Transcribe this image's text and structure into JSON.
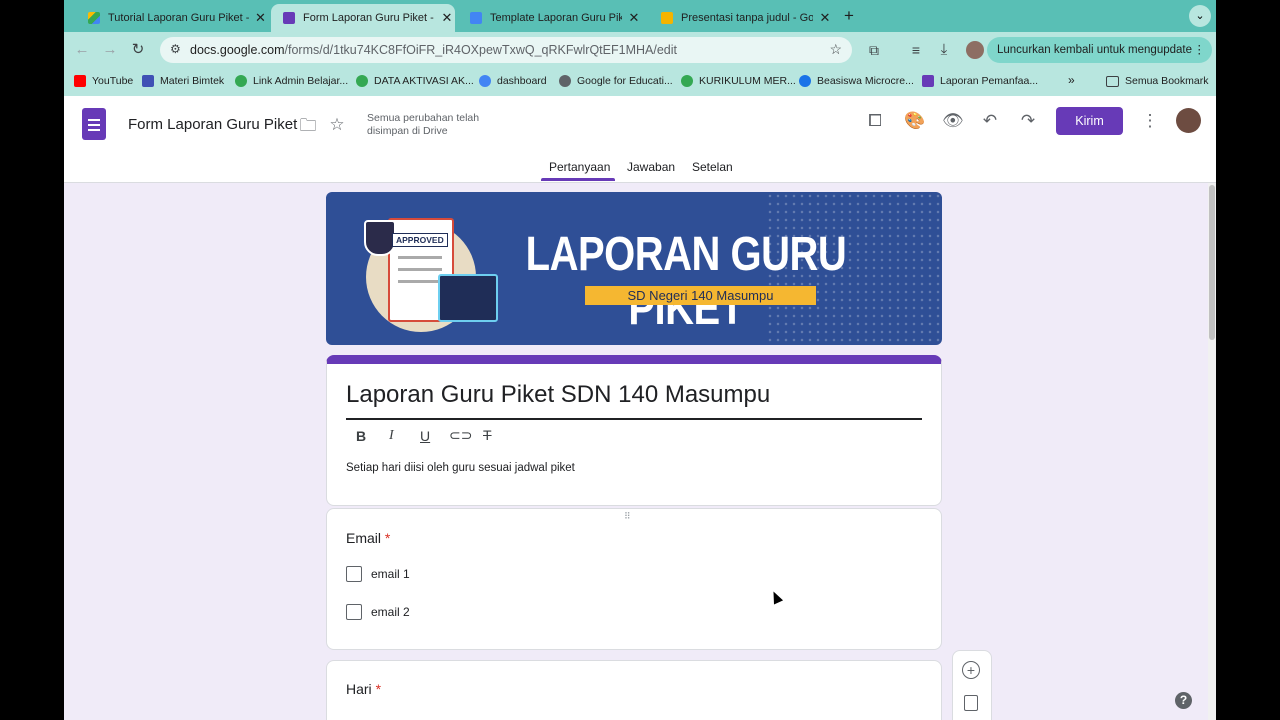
{
  "browser": {
    "tabs": [
      {
        "title": "Tutorial Laporan Guru Piket - ",
        "favicon_color": "#fbbc04",
        "active": false
      },
      {
        "title": "Form Laporan Guru Piket - Go",
        "favicon_color": "#673ab7",
        "active": true
      },
      {
        "title": "Template Laporan Guru Piket",
        "favicon_color": "#4285f4",
        "active": false
      },
      {
        "title": "Presentasi tanpa judul - Goog",
        "favicon_color": "#f4b400",
        "active": false
      }
    ],
    "url_host": "docs.google.com",
    "url_path": "/forms/d/1tku74KC8FfOiFR_iR4OXpewTxwQ_qRKFwlrQtEF1MHA/edit",
    "update_button": "Luncurkan kembali untuk mengupdate",
    "bookmarks": [
      {
        "label": "YouTube",
        "color": "#ff0000"
      },
      {
        "label": "Materi Bimtek",
        "color": "#3f51b5"
      },
      {
        "label": "Link Admin Belajar...",
        "color": "#34a853"
      },
      {
        "label": "DATA AKTIVASI AK...",
        "color": "#34a853"
      },
      {
        "label": "dashboard",
        "color": "#4285f4"
      },
      {
        "label": "Google for Educati...",
        "color": "#5f6368"
      },
      {
        "label": "KURIKULUM MER...",
        "color": "#34a853"
      },
      {
        "label": "Beasiswa Microcre...",
        "color": "#1a73e8"
      },
      {
        "label": "Laporan Pemanfaa...",
        "color": "#673ab7"
      }
    ],
    "all_bookmarks": "Semua Bookmark"
  },
  "form_header": {
    "title": "Form Laporan Guru Piket",
    "save_status_line1": "Semua perubahan telah",
    "save_status_line2": "disimpan di Drive",
    "send_button": "Kirim",
    "tabs": [
      "Pertanyaan",
      "Jawaban",
      "Setelan"
    ],
    "active_tab": "Pertanyaan",
    "accent_color": "#673ab7"
  },
  "banner": {
    "heading": "LAPORAN GURU PIKET",
    "subheading": "SD Negeri 140 Masumpu",
    "stamp": "APPROVED",
    "background": "#2f4f96",
    "ribbon_color": "#f5b731"
  },
  "title_card": {
    "title": "Laporan Guru Piket SDN 140 Masumpu",
    "description": "Setiap hari diisi oleh guru sesuai jadwal piket"
  },
  "questions": [
    {
      "label": "Email",
      "required_mark": "*",
      "options": [
        "email 1",
        "email 2"
      ]
    },
    {
      "label": "Hari",
      "required_mark": "*"
    }
  ]
}
